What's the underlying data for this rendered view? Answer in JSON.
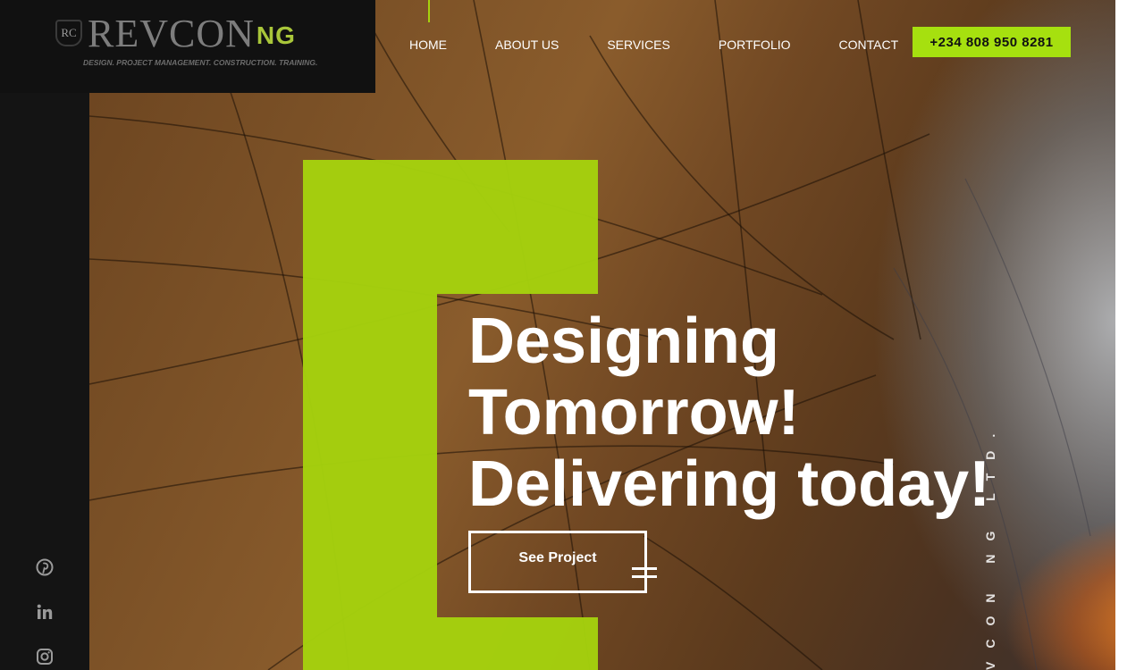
{
  "brand": {
    "badge": "RC",
    "name": "REVCON",
    "suffix": "NG",
    "tagline": "DESIGN. PROJECT MANAGEMENT. CONSTRUCTION. TRAINING."
  },
  "nav": {
    "items": [
      {
        "label": "HOME"
      },
      {
        "label": "ABOUT US"
      },
      {
        "label": "SERVICES"
      },
      {
        "label": "PORTFOLIO"
      },
      {
        "label": "CONTACT"
      }
    ],
    "phone": "+234 808 950 8281"
  },
  "hero": {
    "lines": [
      "Designing",
      "Tomorrow!",
      "Delivering today!"
    ],
    "cta": "See Project",
    "vertical_text": "VCON NG LTD."
  },
  "social": [
    {
      "icon": "pinterest-icon"
    },
    {
      "icon": "linkedin-icon"
    },
    {
      "icon": "instagram-icon"
    }
  ],
  "colors": {
    "accent": "#a6d20e",
    "dark": "#141414"
  }
}
